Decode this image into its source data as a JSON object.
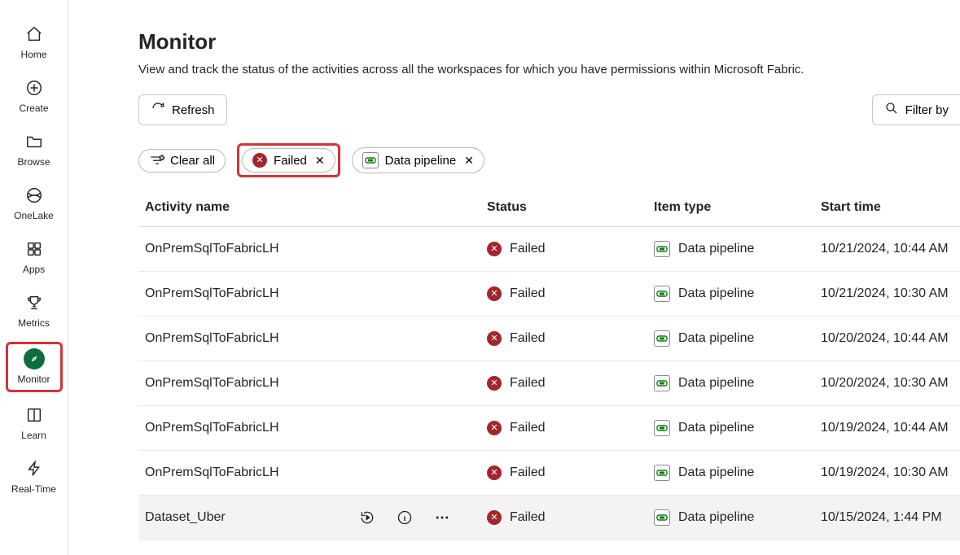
{
  "nav": {
    "items": [
      {
        "id": "home",
        "label": "Home"
      },
      {
        "id": "create",
        "label": "Create"
      },
      {
        "id": "browse",
        "label": "Browse"
      },
      {
        "id": "onelake",
        "label": "OneLake"
      },
      {
        "id": "apps",
        "label": "Apps"
      },
      {
        "id": "metrics",
        "label": "Metrics"
      },
      {
        "id": "monitor",
        "label": "Monitor"
      },
      {
        "id": "learn",
        "label": "Learn"
      },
      {
        "id": "realtime",
        "label": "Real-Time"
      }
    ]
  },
  "page": {
    "title": "Monitor",
    "subtitle": "View and track the status of the activities across all the workspaces for which you have permissions within Microsoft Fabric."
  },
  "toolbar": {
    "refresh_label": "Refresh",
    "filter_label": "Filter by"
  },
  "chips": {
    "clear_label": "Clear all",
    "failed_label": "Failed",
    "pipeline_label": "Data pipeline"
  },
  "table": {
    "headers": {
      "activity": "Activity name",
      "status": "Status",
      "type": "Item type",
      "start": "Start time"
    },
    "rows": [
      {
        "activity": "OnPremSqlToFabricLH",
        "status": "Failed",
        "type": "Data pipeline",
        "start": "10/21/2024, 10:44 AM",
        "selected": false
      },
      {
        "activity": "OnPremSqlToFabricLH",
        "status": "Failed",
        "type": "Data pipeline",
        "start": "10/21/2024, 10:30 AM",
        "selected": false
      },
      {
        "activity": "OnPremSqlToFabricLH",
        "status": "Failed",
        "type": "Data pipeline",
        "start": "10/20/2024, 10:44 AM",
        "selected": false
      },
      {
        "activity": "OnPremSqlToFabricLH",
        "status": "Failed",
        "type": "Data pipeline",
        "start": "10/20/2024, 10:30 AM",
        "selected": false
      },
      {
        "activity": "OnPremSqlToFabricLH",
        "status": "Failed",
        "type": "Data pipeline",
        "start": "10/19/2024, 10:44 AM",
        "selected": false
      },
      {
        "activity": "OnPremSqlToFabricLH",
        "status": "Failed",
        "type": "Data pipeline",
        "start": "10/19/2024, 10:30 AM",
        "selected": false
      },
      {
        "activity": "Dataset_Uber",
        "status": "Failed",
        "type": "Data pipeline",
        "start": "10/15/2024, 1:44 PM",
        "selected": true
      }
    ]
  }
}
